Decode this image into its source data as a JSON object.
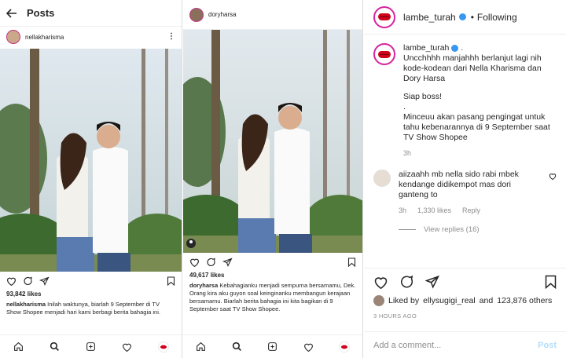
{
  "left": {
    "header_title": "Posts",
    "username": "nellakharisma",
    "likes": "93,842 likes",
    "caption_user": "nellakharisma",
    "caption_text": "Inilah waktunya, biarlah 9 September di TV Show Shopee menjadi hari kami berbagi berita bahagia ini."
  },
  "middle": {
    "username": "doryharsa",
    "likes": "49,617 likes",
    "caption_user": "doryharsa",
    "caption_text": "Kebahagianku menjadi sempurna bersamamu, Dek. Orang kira aku guyon soal keinginanku membangun kerajaan bersamamu. Biarlah berita bahagia ini kita bagikan di 9 September saat TV Show Shopee."
  },
  "right": {
    "account": "lambe_turah",
    "follow_sep": "•",
    "follow_label": "Following",
    "post_author": "lambe_turah",
    "post_dot": ".",
    "post_lines": [
      "Uncchhhh manjahhh berlanjut lagi nih kode-kodean dari Nella Kharisma dan Dory Harsa",
      "Siap boss!",
      ".",
      "Minceuu akan pasang pengingat untuk tahu kebenarannya di 9 September saat TV Show Shopee"
    ],
    "post_time": "3h",
    "comment_user": "aiizaahh",
    "comment_text": "mb nella sido rabi mbek kendange didikempot mas dori ganteng to",
    "comment_time": "3h",
    "comment_likes": "1,330 likes",
    "comment_reply": "Reply",
    "view_replies": "View replies (16)",
    "liked_prefix": "Liked by",
    "liked_user": "ellysugigi_real",
    "liked_suffix": "and",
    "liked_count": "123,876 others",
    "time_ago": "3 HOURS AGO",
    "add_comment_placeholder": "Add a comment...",
    "post_button": "Post",
    "accent": "#3897f0"
  },
  "icons": [
    "back-arrow-icon",
    "more-icon",
    "heart-icon",
    "comment-icon",
    "share-icon",
    "bookmark-icon",
    "home-icon",
    "search-icon",
    "add-icon",
    "activity-icon",
    "profile-icon",
    "verified-icon"
  ]
}
